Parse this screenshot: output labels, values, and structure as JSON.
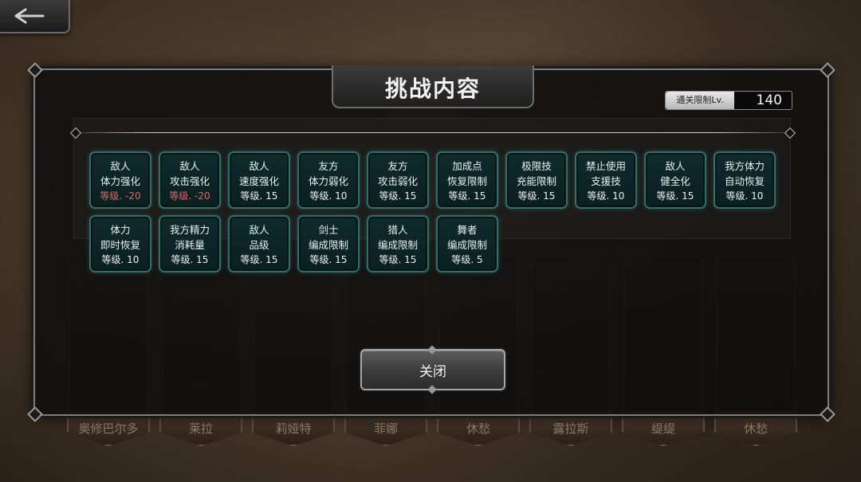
{
  "dialog": {
    "title": "挑战内容",
    "level_limit_label": "通关限制Lv.",
    "level_limit_value": "140",
    "close_label": "关闭"
  },
  "effects": [
    {
      "line1": "敌人",
      "line2": "体力强化",
      "level": "等级. -20",
      "negative": true
    },
    {
      "line1": "敌人",
      "line2": "攻击强化",
      "level": "等级. -20",
      "negative": true
    },
    {
      "line1": "敌人",
      "line2": "速度强化",
      "level": "等级. 15",
      "negative": false
    },
    {
      "line1": "友方",
      "line2": "体力弱化",
      "level": "等级. 10",
      "negative": false
    },
    {
      "line1": "友方",
      "line2": "攻击弱化",
      "level": "等级. 15",
      "negative": false
    },
    {
      "line1": "加成点",
      "line2": "恢复限制",
      "level": "等级. 15",
      "negative": false
    },
    {
      "line1": "极限技",
      "line2": "充能限制",
      "level": "等级. 15",
      "negative": false
    },
    {
      "line1": "禁止使用",
      "line2": "支援技",
      "level": "等级. 10",
      "negative": false
    },
    {
      "line1": "敌人",
      "line2": "健全化",
      "level": "等级. 15",
      "negative": false
    },
    {
      "line1": "我方体力",
      "line2": "自动恢复",
      "level": "等级. 10",
      "negative": false
    },
    {
      "line1": "体力",
      "line2": "即时恢复",
      "level": "等级. 10",
      "negative": false
    },
    {
      "line1": "我方精力",
      "line2": "消耗量",
      "level": "等级. 15",
      "negative": false
    },
    {
      "line1": "敌人",
      "line2": "品级",
      "level": "等级. 15",
      "negative": false
    },
    {
      "line1": "剑士",
      "line2": "编成限制",
      "level": "等级. 15",
      "negative": false
    },
    {
      "line1": "猎人",
      "line2": "编成限制",
      "level": "等级. 15",
      "negative": false
    },
    {
      "line1": "舞者",
      "line2": "编成限制",
      "level": "等级. 5",
      "negative": false
    }
  ],
  "characters": [
    "奥修巴尔多",
    "莱拉",
    "莉娅特",
    "菲娜",
    "休愁",
    "露拉斯",
    "缇缇",
    "休愁"
  ],
  "colors": {
    "tile_border": "#2f6f6d",
    "tile_bg": "#0f2b2c",
    "negative_level": "#e8636a"
  },
  "icons": {
    "back": "back-arrow-icon"
  }
}
